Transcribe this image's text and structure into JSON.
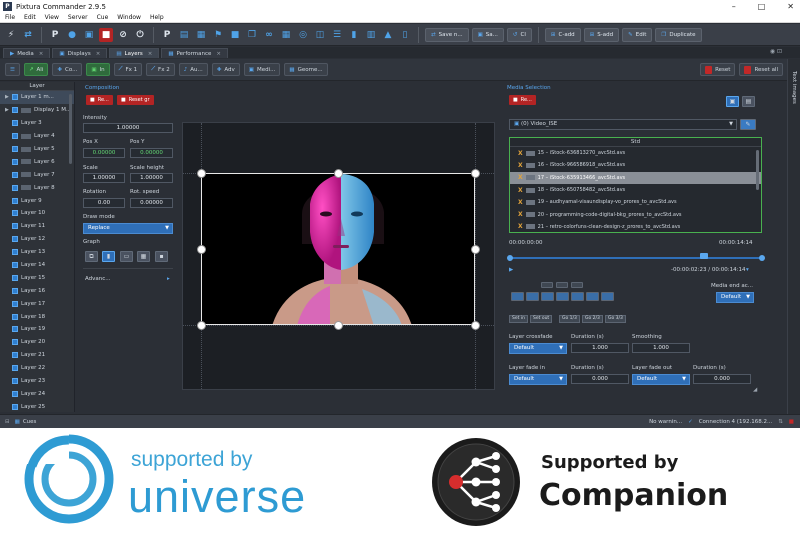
{
  "window": {
    "title": "Pixtura Commander 2.9.5",
    "minimize": "–",
    "maximize": "□",
    "close": "✕"
  },
  "menu": [
    "File",
    "Edit",
    "View",
    "Server",
    "Cue",
    "Window",
    "Help"
  ],
  "toolbar": {
    "save_label": "Save n...",
    "btn2": "Sa...",
    "btn3": "Cl",
    "add1": "C-add",
    "add2": "S-add",
    "edit": "Edit",
    "duplicate": "Duplicate"
  },
  "tabs": [
    {
      "label": "Media",
      "active": false
    },
    {
      "label": "Displays",
      "active": false
    },
    {
      "label": "Layers",
      "active": true
    },
    {
      "label": "Performance",
      "active": false
    }
  ],
  "subtoolbar": {
    "b1": "Ali",
    "b2": "Co...",
    "b3": "In",
    "fx1": "Fx 1",
    "fx2": "Fx 2",
    "au": "Au...",
    "adv": "Adv",
    "med": "Medi...",
    "geo": "Geome...",
    "reset": "Reset",
    "reset_all": "Reset all"
  },
  "side_strip": "Text images",
  "layers": {
    "header": "Layer",
    "items": [
      {
        "label": "Layer 1 m...",
        "selected": true,
        "arrow": true
      },
      {
        "label": "Display 1 M...",
        "selected": false,
        "arrow": true,
        "thumb": true
      },
      {
        "label": "Layer 3",
        "selected": false
      },
      {
        "label": "Layer 4",
        "selected": false,
        "thumb": true
      },
      {
        "label": "Layer 5",
        "selected": false,
        "thumb": true
      },
      {
        "label": "Layer 6",
        "selected": false,
        "thumb": true
      },
      {
        "label": "Layer 7",
        "selected": false,
        "thumb": true
      },
      {
        "label": "Layer 8",
        "selected": false,
        "thumb": true
      },
      {
        "label": "Layer 9",
        "selected": false
      },
      {
        "label": "Layer 10",
        "selected": false
      },
      {
        "label": "Layer 11",
        "selected": false
      },
      {
        "label": "Layer 12",
        "selected": false
      },
      {
        "label": "Layer 13",
        "selected": false
      },
      {
        "label": "Layer 14",
        "selected": false
      },
      {
        "label": "Layer 15",
        "selected": false
      },
      {
        "label": "Layer 16",
        "selected": false
      },
      {
        "label": "Layer 17",
        "selected": false
      },
      {
        "label": "Layer 18",
        "selected": false
      },
      {
        "label": "Layer 19",
        "selected": false
      },
      {
        "label": "Layer 20",
        "selected": false
      },
      {
        "label": "Layer 21",
        "selected": false
      },
      {
        "label": "Layer 22",
        "selected": false
      },
      {
        "label": "Layer 23",
        "selected": false
      },
      {
        "label": "Layer 24",
        "selected": false
      },
      {
        "label": "Layer 25",
        "selected": false
      }
    ]
  },
  "composition": {
    "title": "Composition",
    "re_btn": "Re...",
    "reset_gr": "Reset gr",
    "intensity_label": "Intensity",
    "intensity": "1.00000",
    "posx_label": "Pos X",
    "posx": "0.00000",
    "posy_label": "Pos Y",
    "posy": "0.00000",
    "scale_label": "Scale",
    "scale": "1.00000",
    "scaleh_label": "Scale height",
    "scaleh": "1.00000",
    "rotation_label": "Rotation",
    "rotation": "0.00",
    "rotspeed_label": "Rot. speed",
    "rotspeed": "0.00000",
    "drawmode_label": "Draw mode",
    "drawmode": "Replace",
    "graph_label": "Graph",
    "advanced": "Advanc..."
  },
  "media": {
    "title": "Media Selection",
    "re_btn": "Re...",
    "folder": "(0) Video_ISE",
    "list_header": "Std",
    "items": [
      {
        "label": "15 – iStock-636813270_avcStd.avs",
        "selected": false
      },
      {
        "label": "16 – iStock-966586918_avcStd.avs",
        "selected": false
      },
      {
        "label": "17 – iStock-635913466_avcStd.avs",
        "selected": true
      },
      {
        "label": "18 – iStock-650758482_avcStd.avs",
        "selected": false
      },
      {
        "label": "19 – audhyamal-visaundisplay-vo_prores_to_avcStd.avs",
        "selected": false
      },
      {
        "label": "20 – programming-code-digital-bkg_prores_to_avcStd.avs",
        "selected": false
      },
      {
        "label": "21 – retro-colorfuns-clean-design-z_prores_to_avcStd.avs",
        "selected": false
      }
    ],
    "time_start": "00:00:00:00",
    "time_end": "00:00:14:14",
    "time_remaining": "-00:00:02:23 / 00:00:14:14",
    "media_end_label": "Media end ac...",
    "media_end": "Default",
    "set_in": "Set in",
    "set_out": "Set out",
    "go_to": "Go 1/3",
    "go_to2": "Go 2/3",
    "go_to3": "Go 3/3",
    "crossfade_label": "Layer crossfade",
    "crossfade": "Default",
    "duration_label": "Duration (s)",
    "duration": "1.000",
    "smoothing_label": "Smoothing",
    "smoothing": "1.000",
    "fadein_label": "Layer fade in",
    "fadein": "Default",
    "fadein_dur_label": "Duration (s)",
    "fadein_dur": "0.000",
    "fadeout_label": "Layer fade out",
    "fadeout": "Default",
    "fadeout_dur_label": "Duration (s)",
    "fadeout_dur": "0.000"
  },
  "status": {
    "cues": "Cues",
    "warning": "No warnin...",
    "connection": "Connection 4 (192.168.2..."
  },
  "logos": {
    "universe_line1": "supported by",
    "universe_line2": "universe",
    "companion_line1": "Supported by",
    "companion_line2": "Companion"
  },
  "colors": {
    "universe_blue": "#2e9bd3",
    "companion_red": "#d62d2d",
    "accent_blue": "#5aa7ee",
    "reset_red": "#c22828",
    "green_active": "#2f6b3c"
  }
}
